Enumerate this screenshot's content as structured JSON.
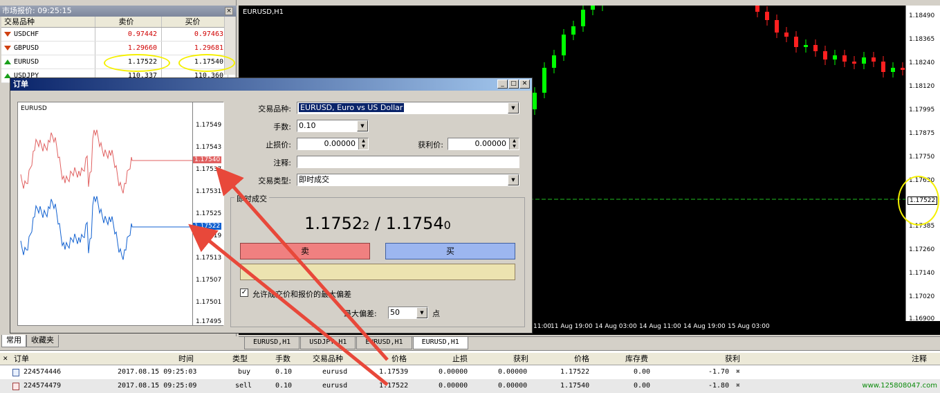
{
  "market_watch": {
    "title": "市场报价: 09:25:15",
    "close": "×",
    "headers": {
      "symbol": "交易品种",
      "bid": "卖价",
      "ask": "买价"
    },
    "rows": [
      {
        "symbol": "USDCHF",
        "bid": "0.97442",
        "ask": "0.97463",
        "dir": "down",
        "color": "red"
      },
      {
        "symbol": "GBPUSD",
        "bid": "1.29660",
        "ask": "1.29681",
        "dir": "down",
        "color": "red"
      },
      {
        "symbol": "EURUSD",
        "bid": "1.17522",
        "ask": "1.17540",
        "dir": "up",
        "color": "black"
      },
      {
        "symbol": "USDJPY",
        "bid": "110.337",
        "ask": "110.360",
        "dir": "up",
        "color": "black"
      }
    ],
    "tabs": [
      "常用",
      "收藏夹"
    ]
  },
  "chart": {
    "title": "EURUSD,H1",
    "price_labels": [
      "1.18490",
      "1.18365",
      "1.18240",
      "1.18120",
      "1.17995",
      "1.17875",
      "1.17750",
      "1.17630",
      "1.17522",
      "1.17385",
      "1.17260",
      "1.17140",
      "1.17020",
      "1.16900"
    ],
    "time_labels": [
      "11:00",
      "11 Aug 19:00",
      "14 Aug 03:00",
      "14 Aug 11:00",
      "14 Aug 19:00",
      "15 Aug 03:00"
    ],
    "tabs": [
      "EURUSD,H1",
      "USDJPY,H1",
      "EURUSD,H1",
      "EURUSD,H1"
    ],
    "active_tab": 3
  },
  "order_dialog": {
    "title": "订单",
    "mini_chart": {
      "symbol": "EURUSD",
      "price_labels": [
        "1.17549",
        "1.17543",
        "1.17537",
        "1.17531",
        "1.17525",
        "1.17519",
        "1.17513",
        "1.17507",
        "1.17501",
        "1.17495"
      ],
      "ask_tag": "1.17540",
      "bid_tag": "1.17522"
    },
    "fields": {
      "symbol_label": "交易品种:",
      "symbol_value": "EURUSD, Euro vs US Dollar",
      "volume_label": "手数:",
      "volume_value": "0.10",
      "sl_label": "止损价:",
      "sl_value": "0.00000",
      "tp_label": "获利价:",
      "tp_value": "0.00000",
      "comment_label": "注释:",
      "comment_value": "",
      "type_label": "交易类型:",
      "type_value": "即时成交"
    },
    "group_label": "即时成交",
    "quote": {
      "bid_main": "1.1752",
      "bid_small": "2",
      "sep": " / ",
      "ask_main": "1.1754",
      "ask_small": "0"
    },
    "sell_label": "卖",
    "buy_label": "买",
    "deviation_check_label": "允许成交价和报价的最大偏差",
    "deviation_label": "最大偏差:",
    "deviation_value": "50",
    "deviation_unit": "点"
  },
  "terminal": {
    "headers": [
      "订单",
      "时间",
      "类型",
      "手数",
      "交易品种",
      "价格",
      "止损",
      "获利",
      "价格",
      "库存费",
      "获利",
      "注释"
    ],
    "rows": [
      {
        "ticket": "224574446",
        "time": "2017.08.15 09:25:03",
        "type": "buy",
        "volume": "0.10",
        "symbol": "eurusd",
        "price": "1.17539",
        "sl": "0.00000",
        "tp": "0.00000",
        "cur": "1.17522",
        "swap": "0.00",
        "profit": "-1.70"
      },
      {
        "ticket": "224574479",
        "time": "2017.08.15 09:25:09",
        "type": "sell",
        "volume": "0.10",
        "symbol": "eurusd",
        "price": "1.17522",
        "sl": "0.00000",
        "tp": "0.00000",
        "cur": "1.17540",
        "swap": "0.00",
        "profit": "-1.80"
      }
    ]
  },
  "watermark": "www.125808047.com",
  "colors": {
    "candle_up": "#00ff00",
    "candle_down": "#ff2020",
    "ask_line": "#e06060",
    "bid_line": "#1060d0",
    "arrow": "#e8483a",
    "highlight": "#f5f000"
  }
}
